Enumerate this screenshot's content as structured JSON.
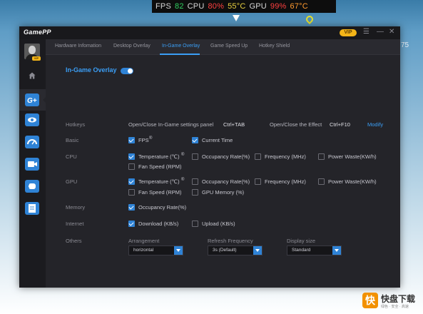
{
  "hud": {
    "fps_label": "FPS",
    "fps_value": "82",
    "cpu_label": "CPU",
    "cpu_load": "80%",
    "cpu_temp": "55°C",
    "gpu_label": "GPU",
    "gpu_load": "99%",
    "gpu_temp": "67°C"
  },
  "background": {
    "side_text": "75"
  },
  "app": {
    "title": "GamePP",
    "vip_badge": "VIP",
    "avatar_vip": "VIP"
  },
  "tabs": [
    {
      "label": "Hardware Infomation"
    },
    {
      "label": "Desktop Overlay"
    },
    {
      "label": "In-Game Overlay",
      "active": true
    },
    {
      "label": "Game Speed Up"
    },
    {
      "label": "Hotkey Shield"
    }
  ],
  "sidebar": {
    "items": [
      {
        "icon": "home-icon"
      },
      {
        "icon": "game-plus-icon",
        "active": true
      },
      {
        "icon": "eye-icon"
      },
      {
        "icon": "speedometer-icon"
      },
      {
        "icon": "video-camera-icon"
      },
      {
        "icon": "speed-boost-icon"
      },
      {
        "icon": "document-icon"
      }
    ]
  },
  "overlay": {
    "title": "In-Game Overlay",
    "enabled": true,
    "hotkeys": {
      "label": "Hotkeys",
      "open_close_settings_label": "Open/Close In-Game settings panel",
      "open_close_settings_key": "Ctrl+TAB",
      "open_close_effect_label": "Open/Close the Effect",
      "open_close_effect_key": "Ctrl+F10",
      "modify_label": "Modify"
    },
    "basic": {
      "label": "Basic",
      "fps": {
        "label": "FPS",
        "checked": true,
        "info": "®"
      },
      "current_time": {
        "label": "Current Time",
        "checked": true
      }
    },
    "cpu": {
      "label": "CPU",
      "temperature": {
        "label": "Temperature (℃)",
        "checked": true,
        "info": "®"
      },
      "occupancy": {
        "label": "Occupancy Rate(%)",
        "checked": false
      },
      "frequency": {
        "label": "Frequency (MHz)",
        "checked": false
      },
      "power_waste": {
        "label": "Power Waste(KW/h)",
        "checked": false
      },
      "fan_speed": {
        "label": "Fan Speed (RPM)",
        "checked": false
      }
    },
    "gpu": {
      "label": "GPU",
      "temperature": {
        "label": "Temperature (℃)",
        "checked": true,
        "info": "®"
      },
      "occupancy": {
        "label": "Occupancy Rate(%)",
        "checked": false
      },
      "frequency": {
        "label": "Frequency (MHz)",
        "checked": false
      },
      "power_waste": {
        "label": "Power Waste(KW/h)",
        "checked": false
      },
      "fan_speed": {
        "label": "Fan Speed (RPM)",
        "checked": false
      },
      "gpu_memory": {
        "label": "GPU Memory (%)",
        "checked": false
      }
    },
    "memory": {
      "label": "Memory",
      "occupancy": {
        "label": "Occupancy Rate(%)",
        "checked": true
      }
    },
    "internet": {
      "label": "Internet",
      "download": {
        "label": "Download (KB/s)",
        "checked": true
      },
      "upload": {
        "label": "Upload (KB/s)",
        "checked": false
      }
    },
    "others": {
      "label": "Others",
      "arrangement": {
        "label": "Arrangement",
        "value": "horizontal"
      },
      "refresh": {
        "label": "Refresh Frequency",
        "value": "3s (Default)"
      },
      "display_size": {
        "label": "Display size",
        "value": "Standard"
      }
    }
  },
  "watermark": {
    "logo_text": "快",
    "name": "快盘下载",
    "tagline": "绿色 · 安全 · 高速"
  },
  "colors": {
    "accent": "#3b9ef5",
    "vip": "#f4b518",
    "panel": "#242429"
  }
}
